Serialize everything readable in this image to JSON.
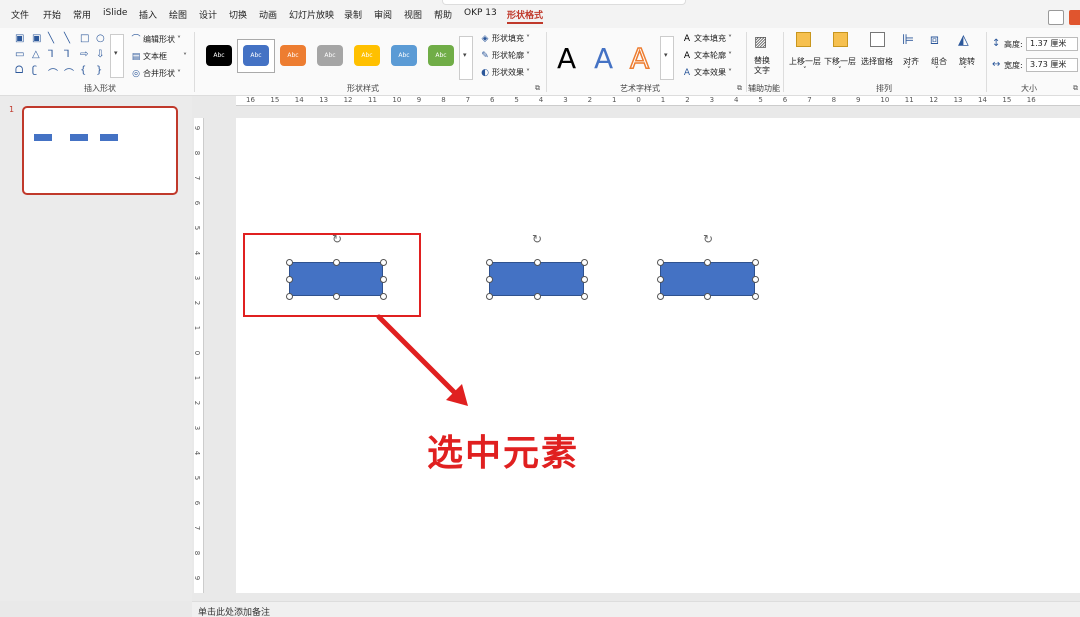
{
  "menu": [
    {
      "label": "文件",
      "active": false
    },
    {
      "label": "开始",
      "active": false
    },
    {
      "label": "常用",
      "active": false
    },
    {
      "label": "iSlide",
      "active": false
    },
    {
      "label": "插入",
      "active": false
    },
    {
      "label": "绘图",
      "active": false
    },
    {
      "label": "设计",
      "active": false
    },
    {
      "label": "切换",
      "active": false
    },
    {
      "label": "动画",
      "active": false
    },
    {
      "label": "幻灯片放映",
      "active": false
    },
    {
      "label": "录制",
      "active": false
    },
    {
      "label": "审阅",
      "active": false
    },
    {
      "label": "视图",
      "active": false
    },
    {
      "label": "帮助",
      "active": false
    },
    {
      "label": "OKP 13",
      "active": false
    },
    {
      "label": "形状格式",
      "active": true
    }
  ],
  "ribbon": {
    "insert_shapes": {
      "label": "插入形状",
      "edit_shape": "编辑形状",
      "text_box": "文本框",
      "merge_shapes": "合并形状"
    },
    "shape_styles": {
      "label": "形状样式",
      "swatch_text": "Abc",
      "swatches": [
        "#000000",
        "#4472c4",
        "#ed7d31",
        "#a5a5a5",
        "#ffc000",
        "#5b9bd5",
        "#70ad47"
      ],
      "shape_fill": "形状填充",
      "shape_outline": "形状轮廓",
      "shape_effects": "形状效果"
    },
    "wordart": {
      "label": "艺术字样式",
      "letter": "A",
      "text_fill": "文本填充",
      "text_outline": "文本轮廓",
      "text_effects": "文本效果"
    },
    "accessibility": {
      "label": "辅助功能",
      "alt_text_line1": "替换",
      "alt_text_line2": "文字"
    },
    "arrange": {
      "label": "排列",
      "bring_forward": "上移一层",
      "send_backward": "下移一层",
      "selection_pane": "选择窗格",
      "align": "对齐",
      "group": "组合",
      "rotate": "旋转"
    },
    "size": {
      "label": "大小",
      "height_label": "高度:",
      "height_value": "1.37 厘米",
      "width_label": "宽度:",
      "width_value": "3.73 厘米"
    }
  },
  "ruler": {
    "horizontal": [
      "16",
      "15",
      "14",
      "13",
      "12",
      "11",
      "10",
      "9",
      "8",
      "7",
      "6",
      "5",
      "4",
      "3",
      "2",
      "1",
      "0",
      "1",
      "2",
      "3",
      "4",
      "5",
      "6",
      "7",
      "8",
      "9",
      "10",
      "11",
      "12",
      "13",
      "14",
      "15",
      "16"
    ],
    "vertical": [
      "9",
      "8",
      "7",
      "6",
      "5",
      "4",
      "3",
      "2",
      "1",
      "0",
      "1",
      "2",
      "3",
      "4",
      "5",
      "6",
      "7",
      "8",
      "9"
    ]
  },
  "thumbnails": {
    "slide_number": "1"
  },
  "canvas": {
    "annotation_text": "选中元素",
    "accent_color": "#e02020",
    "shape_color": "#4472c4"
  },
  "notes": {
    "placeholder": "单击此处添加备注"
  }
}
